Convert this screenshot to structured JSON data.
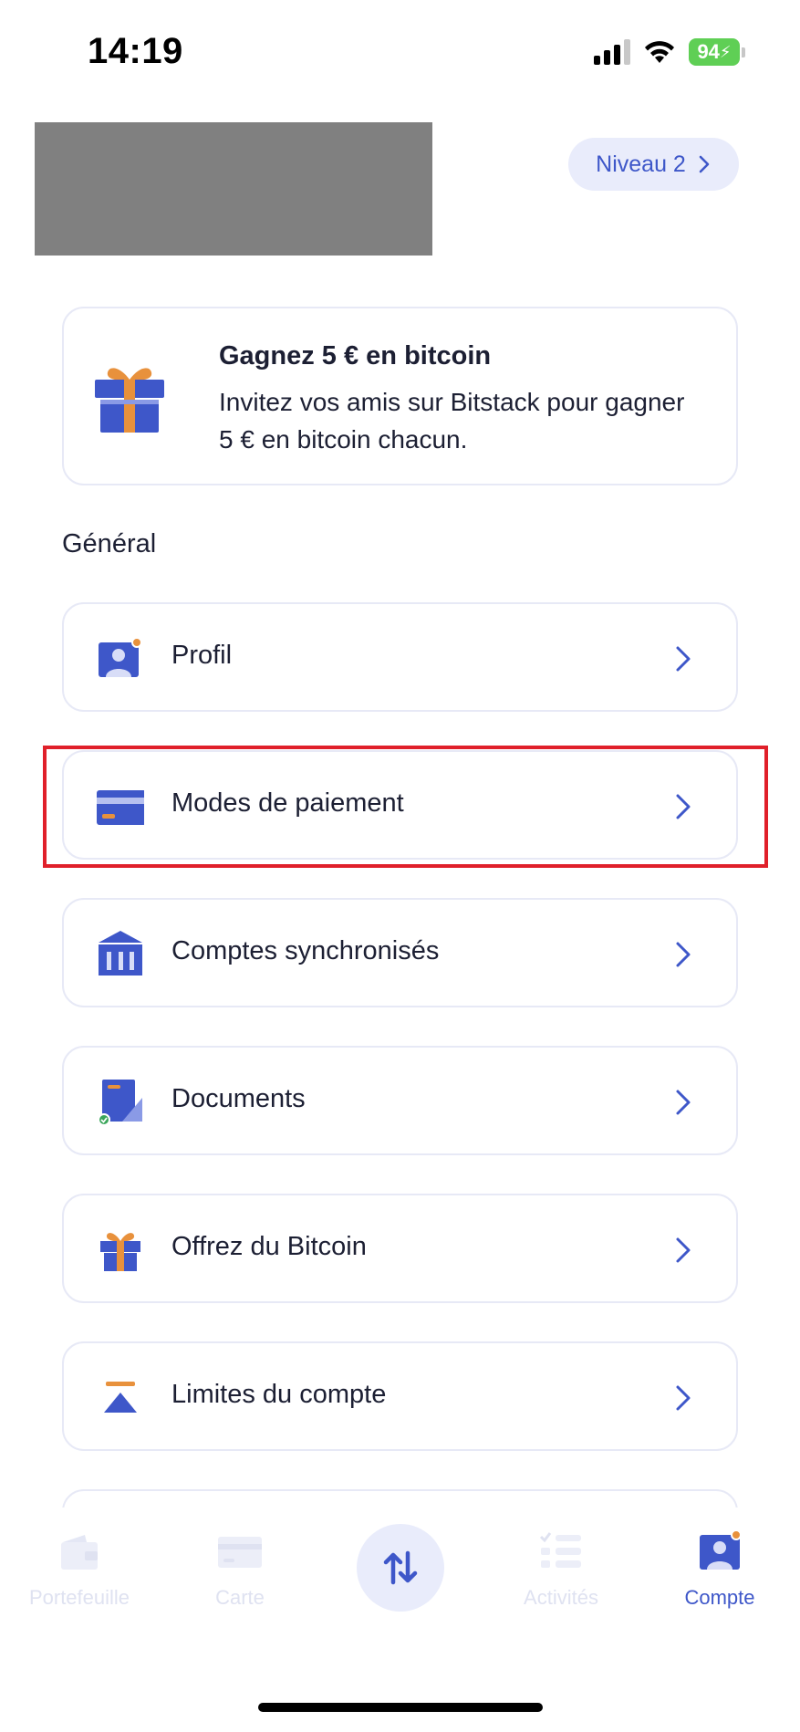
{
  "status_bar": {
    "time": "14:19",
    "battery": "94",
    "icons": [
      "signal-icon",
      "wifi-icon",
      "battery-charging-icon"
    ]
  },
  "header": {
    "level_label": "Niveau 2"
  },
  "promo": {
    "title": "Gagnez 5 € en bitcoin",
    "text": "Invitez vos amis sur Bitstack pour gagner 5 € en bitcoin chacun.",
    "icon": "gift-icon"
  },
  "section": {
    "title": "Général"
  },
  "menu": {
    "items": [
      {
        "label": "Profil",
        "icon": "profile-icon"
      },
      {
        "label": "Modes de paiement",
        "icon": "credit-card-icon"
      },
      {
        "label": "Comptes synchronisés",
        "icon": "bank-icon"
      },
      {
        "label": "Documents",
        "icon": "document-icon"
      },
      {
        "label": "Offrez du Bitcoin",
        "icon": "gift-icon"
      },
      {
        "label": "Limites du compte",
        "icon": "limits-icon"
      }
    ]
  },
  "tab_bar": {
    "tabs": [
      {
        "label": "Portefeuille",
        "icon": "wallet-icon",
        "active": false
      },
      {
        "label": "Carte",
        "icon": "card-icon",
        "active": false
      },
      {
        "label": "",
        "icon": "swap-arrows-icon",
        "active": false
      },
      {
        "label": "Activités",
        "icon": "activity-list-icon",
        "active": false
      },
      {
        "label": "Compte",
        "icon": "account-icon",
        "active": true
      }
    ]
  },
  "colors": {
    "accent": "#3e57c9",
    "accent_light": "#e9ecfb",
    "orange": "#e8913c",
    "border": "#e7e9f6",
    "highlight": "#e0202a",
    "inactive_tab": "#dfe2f1"
  }
}
